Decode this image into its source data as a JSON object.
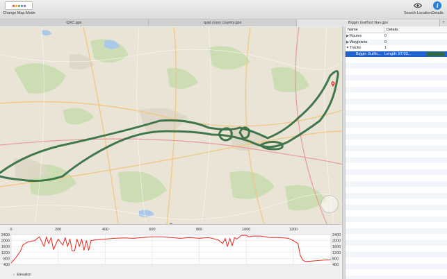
{
  "toolbar": {
    "change_map_mode": "Change Map Mode",
    "search_location": "Search Location",
    "details": "Details"
  },
  "tabs": [
    {
      "label": "QXC.gpx",
      "active": false
    },
    {
      "label": "qual cross country.gpx",
      "active": false
    },
    {
      "label": "Biggin Guilford Nav.gpx",
      "active": true
    }
  ],
  "outline": {
    "columns": [
      "Name",
      "Details"
    ],
    "rows": [
      {
        "name": "Routes",
        "details": "0",
        "expandable": true,
        "expanded": false
      },
      {
        "name": "Waypoints",
        "details": "0",
        "expandable": true,
        "expanded": false
      },
      {
        "name": "Tracks",
        "details": "1",
        "expandable": true,
        "expanded": true
      },
      {
        "name": "Biggin Guilfo...",
        "details": "Length: 87.03...",
        "selected": true,
        "track_color": "#2d6b3d"
      }
    ]
  },
  "elevation": {
    "label": "Elevation",
    "toggle_icon": "triangle-right-icon"
  },
  "chart_data": {
    "type": "line",
    "title": "",
    "xlabel": "",
    "ylabel": "",
    "xlim": [
      0,
      1360
    ],
    "ylim": [
      400,
      2400
    ],
    "x_ticks": [
      0,
      200,
      400,
      600,
      800,
      1000,
      1200
    ],
    "y_ticks": [
      400,
      800,
      1200,
      1600,
      2000,
      2400
    ],
    "grid": true,
    "series": [
      {
        "color": "#e8281e",
        "x": [
          0,
          20,
          40,
          50,
          70,
          100,
          120,
          140,
          150,
          160,
          170,
          180,
          200,
          220,
          230,
          240,
          250,
          260,
          270,
          280,
          290,
          300,
          310,
          320,
          330,
          340,
          360,
          400,
          440,
          480,
          520,
          560,
          600,
          640,
          680,
          720,
          760,
          800,
          840,
          880,
          900,
          910,
          920,
          930,
          940,
          950,
          960,
          980,
          1000,
          1010,
          1030,
          1060,
          1100,
          1140,
          1180,
          1200,
          1220,
          1230,
          1240,
          1250,
          1260,
          1300,
          1340,
          1360
        ],
        "y": [
          500,
          850,
          1300,
          1700,
          1900,
          2000,
          2250,
          1600,
          2250,
          1800,
          2200,
          1400,
          2100,
          1700,
          2200,
          1600,
          2100,
          1300,
          1300,
          2100,
          1600,
          2100,
          1350,
          2000,
          1350,
          2000,
          2050,
          2100,
          2150,
          2180,
          2150,
          2200,
          2250,
          2250,
          2200,
          2150,
          2200,
          2150,
          2200,
          2050,
          1800,
          2150,
          1600,
          2150,
          1650,
          2200,
          2100,
          2350,
          2350,
          2250,
          2300,
          2300,
          2200,
          2200,
          2150,
          2000,
          1800,
          1000,
          700,
          600,
          600,
          650,
          700,
          700
        ]
      }
    ]
  }
}
